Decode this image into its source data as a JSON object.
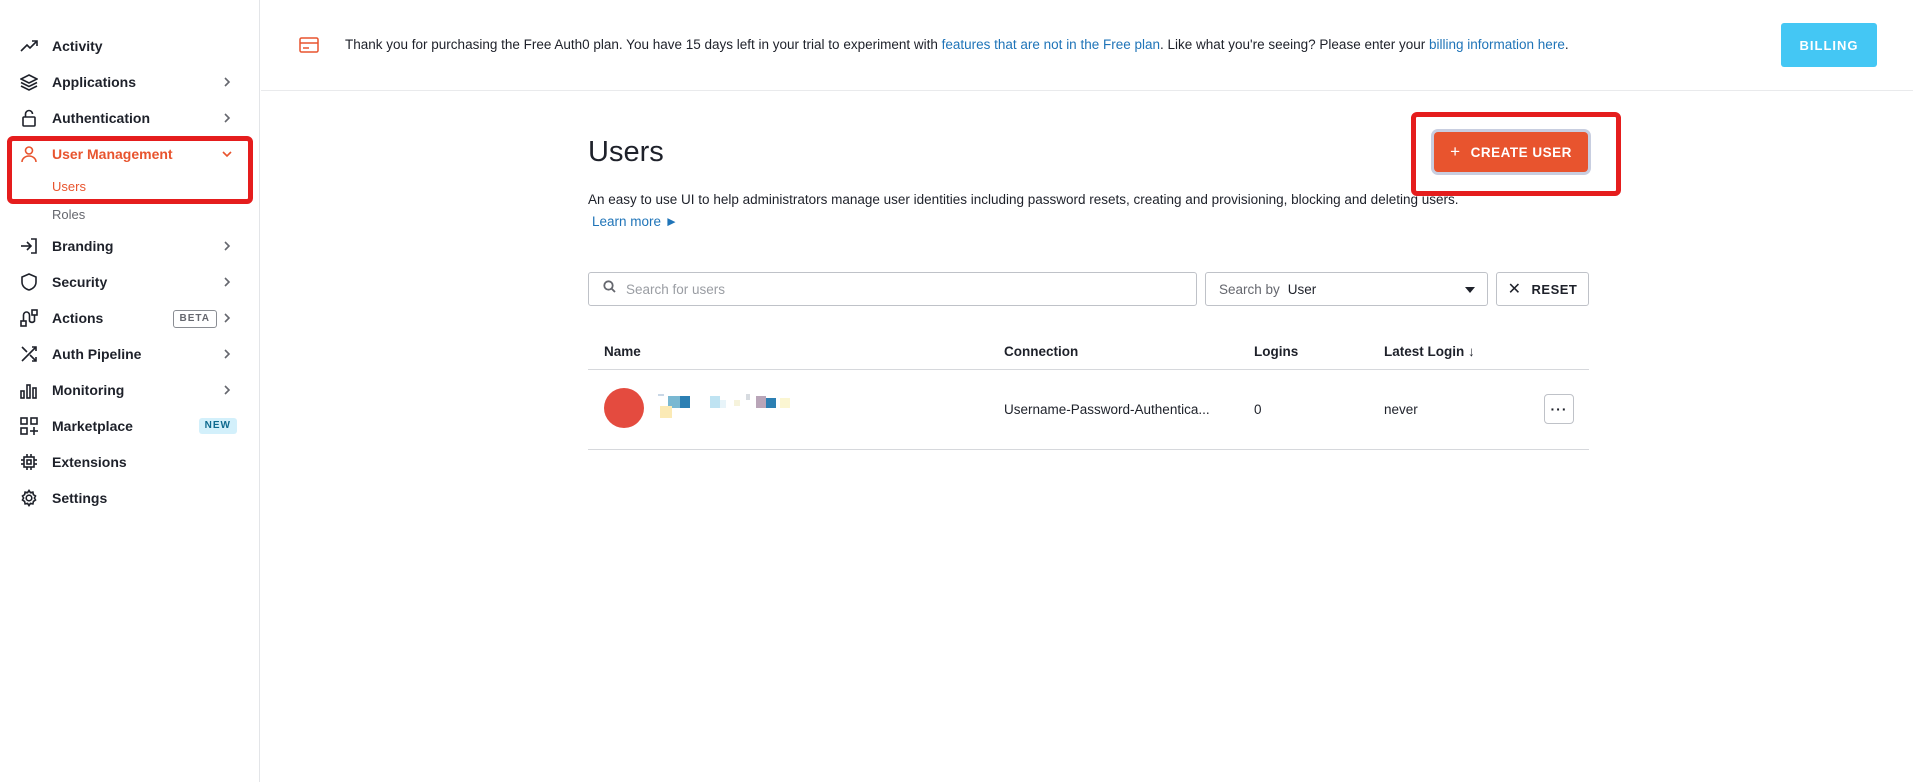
{
  "sidebar": {
    "items": [
      {
        "label": "Activity"
      },
      {
        "label": "Applications"
      },
      {
        "label": "Authentication"
      },
      {
        "label": "User Management",
        "subitems": [
          {
            "label": "Users"
          },
          {
            "label": "Roles"
          }
        ]
      },
      {
        "label": "Branding"
      },
      {
        "label": "Security"
      },
      {
        "label": "Actions",
        "badge": "BETA"
      },
      {
        "label": "Auth Pipeline"
      },
      {
        "label": "Monitoring"
      },
      {
        "label": "Marketplace",
        "badge": "NEW"
      },
      {
        "label": "Extensions"
      },
      {
        "label": "Settings"
      }
    ]
  },
  "banner": {
    "text_before": "Thank you for purchasing the Free Auth0 plan. You have 15 days left in your trial to experiment with ",
    "link1": "features that are not in the Free plan",
    "text_middle": ". Like what you're seeing? Please enter your ",
    "link2": "billing information here",
    "text_after": ".",
    "billing_button": "BILLING"
  },
  "main": {
    "title": "Users",
    "create_button": "CREATE USER",
    "description": "An easy to use UI to help administrators manage user identities including password resets, creating and provisioning, blocking and deleting users.",
    "learn_more": "Learn more ►",
    "search": {
      "placeholder": "Search for users",
      "search_by_label": "Search by",
      "search_by_value": "User",
      "reset_button": "RESET"
    },
    "table": {
      "headers": [
        "Name",
        "Connection",
        "Logins",
        "Latest Login ↓"
      ],
      "rows": [
        {
          "connection": "Username-Password-Authentica...",
          "logins": "0",
          "latest_login": "never"
        }
      ]
    }
  },
  "colors": {
    "accent": "#e8542e",
    "billing": "#44c7f4",
    "link": "#1f74b8",
    "avatar": "#e44b3f",
    "highlight": "#e51d1d"
  }
}
